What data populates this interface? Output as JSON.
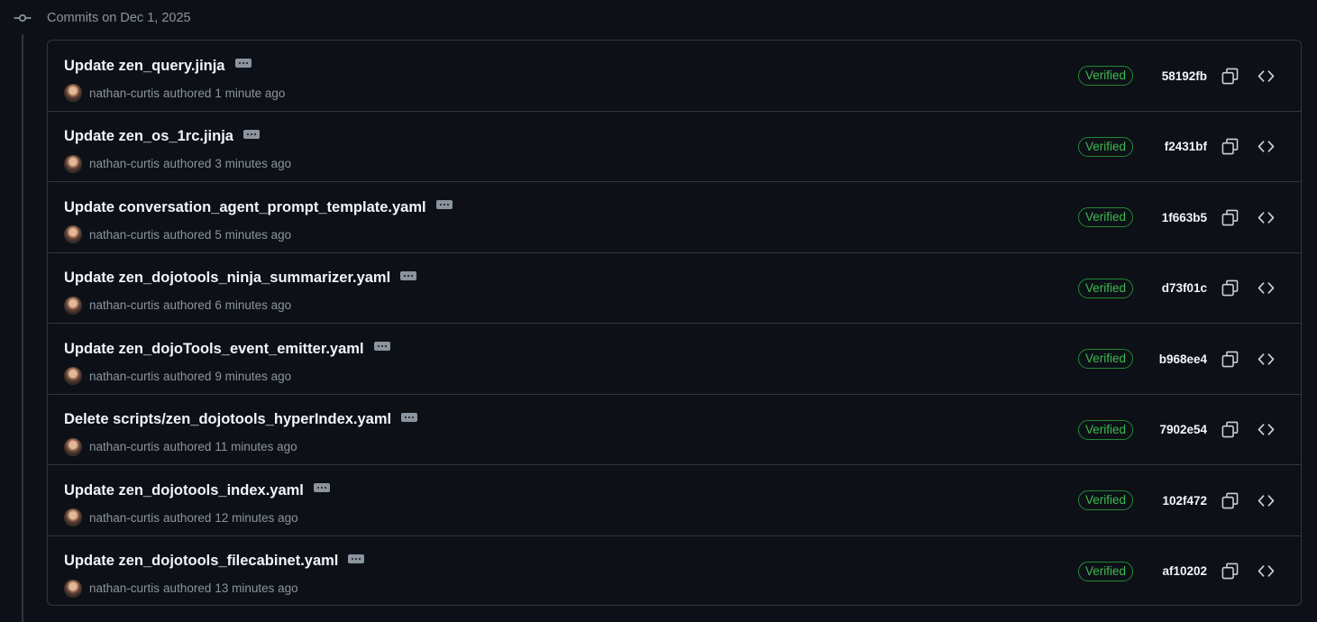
{
  "date_header": {
    "label": "Commits on Dec 1, 2025"
  },
  "commits": [
    {
      "message": "Update zen_query.jinja",
      "author": "nathan-curtis",
      "authored": "authored",
      "time_ago": "1 minute ago",
      "verified": "Verified",
      "sha": "58192fb"
    },
    {
      "message": "Update zen_os_1rc.jinja",
      "author": "nathan-curtis",
      "authored": "authored",
      "time_ago": "3 minutes ago",
      "verified": "Verified",
      "sha": "f2431bf"
    },
    {
      "message": "Update conversation_agent_prompt_template.yaml",
      "author": "nathan-curtis",
      "authored": "authored",
      "time_ago": "5 minutes ago",
      "verified": "Verified",
      "sha": "1f663b5"
    },
    {
      "message": "Update zen_dojotools_ninja_summarizer.yaml",
      "author": "nathan-curtis",
      "authored": "authored",
      "time_ago": "6 minutes ago",
      "verified": "Verified",
      "sha": "d73f01c"
    },
    {
      "message": "Update zen_dojoTools_event_emitter.yaml",
      "author": "nathan-curtis",
      "authored": "authored",
      "time_ago": "9 minutes ago",
      "verified": "Verified",
      "sha": "b968ee4"
    },
    {
      "message": "Delete scripts/zen_dojotools_hyperIndex.yaml",
      "author": "nathan-curtis",
      "authored": "authored",
      "time_ago": "11 minutes ago",
      "verified": "Verified",
      "sha": "7902e54"
    },
    {
      "message": "Update zen_dojotools_index.yaml",
      "author": "nathan-curtis",
      "authored": "authored",
      "time_ago": "12 minutes ago",
      "verified": "Verified",
      "sha": "102f472"
    },
    {
      "message": "Update zen_dojotools_filecabinet.yaml",
      "author": "nathan-curtis",
      "authored": "authored",
      "time_ago": "13 minutes ago",
      "verified": "Verified",
      "sha": "af10202"
    }
  ],
  "icons": {
    "commit": "git-commit-icon",
    "ellipsis": "ellipsis-icon",
    "copy": "copy-icon",
    "code": "code-icon"
  },
  "colors": {
    "background": "#0d1117",
    "border": "#30363d",
    "verified": "#3fb950",
    "muted": "#8b949e"
  }
}
